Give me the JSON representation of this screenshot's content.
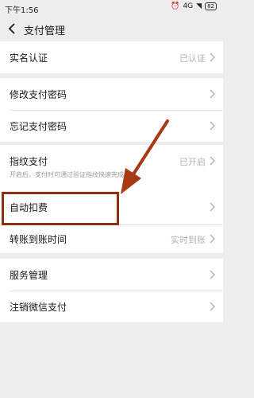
{
  "status_bar": {
    "time": "下午1:56",
    "network": "4G",
    "battery": "82"
  },
  "nav": {
    "title": "支付管理"
  },
  "rows": [
    {
      "label": "实名认证",
      "value": "已认证"
    },
    {
      "label": "修改支付密码",
      "value": ""
    },
    {
      "label": "忘记支付密码",
      "value": ""
    },
    {
      "label": "指纹支付",
      "value": "已开启",
      "hint": "开启后，支付时可通过验证指纹快速完成付款"
    },
    {
      "label": "自动扣费",
      "value": ""
    },
    {
      "label": "转账到账时间",
      "value": "实时到账"
    },
    {
      "label": "服务管理",
      "value": ""
    },
    {
      "label": "注销微信支付",
      "value": ""
    }
  ],
  "colors": {
    "background": "#ededed",
    "annotation": "#a73a14"
  }
}
